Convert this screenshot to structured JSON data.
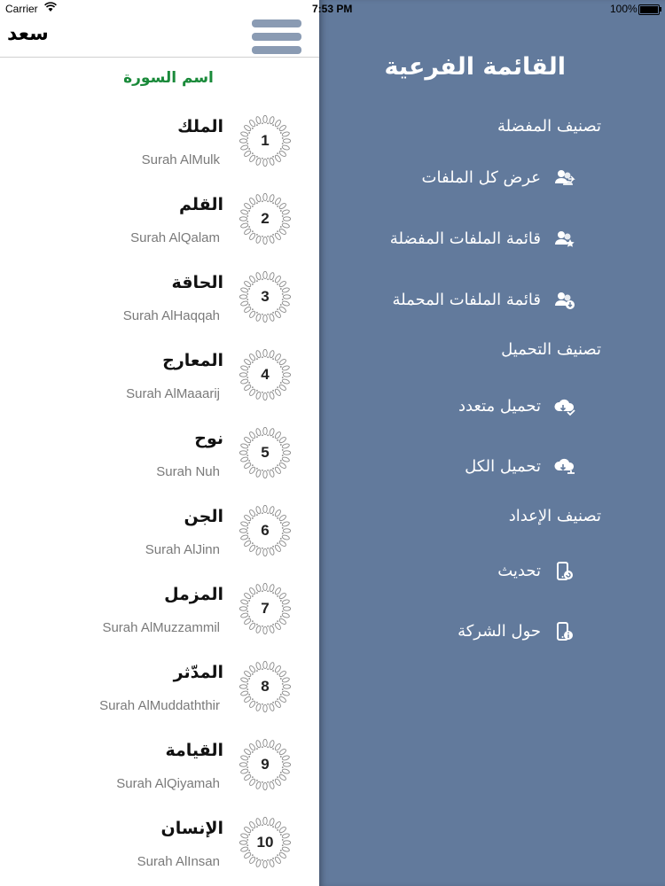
{
  "status_bar": {
    "carrier": "Carrier",
    "time": "7:53 PM",
    "battery": "100%"
  },
  "nav": {
    "title": "سعد"
  },
  "list": {
    "header": "اسم السورة",
    "items": [
      {
        "number": "1",
        "arabic": "الملك",
        "latin": "Surah AlMulk"
      },
      {
        "number": "2",
        "arabic": "القلم",
        "latin": "Surah AlQalam"
      },
      {
        "number": "3",
        "arabic": "الحاقة",
        "latin": "Surah AlHaqqah"
      },
      {
        "number": "4",
        "arabic": "المعارج",
        "latin": "Surah AlMaaarij"
      },
      {
        "number": "5",
        "arabic": "نوح",
        "latin": "Surah Nuh"
      },
      {
        "number": "6",
        "arabic": "الجن",
        "latin": "Surah AlJinn"
      },
      {
        "number": "7",
        "arabic": "المزمل",
        "latin": "Surah AlMuzzammil"
      },
      {
        "number": "8",
        "arabic": "المدّثر",
        "latin": "Surah AlMuddaththir"
      },
      {
        "number": "9",
        "arabic": "القيامة",
        "latin": "Surah AlQiyamah"
      },
      {
        "number": "10",
        "arabic": "الإنسان",
        "latin": "Surah AlInsan"
      }
    ]
  },
  "side_menu": {
    "title": "القائمة الفرعية",
    "sections": [
      {
        "header": "تصنيف المفضلة",
        "items": [
          {
            "label": "عرض كل الملفات",
            "icon": "users-icon"
          },
          {
            "label": "قائمة الملفات المفضلة",
            "icon": "users-star-icon"
          },
          {
            "label": "قائمة الملفات المحملة",
            "icon": "users-download-icon"
          }
        ]
      },
      {
        "header": "تصنيف التحميل",
        "items": [
          {
            "label": "تحميل متعدد",
            "icon": "cloud-download-icon"
          },
          {
            "label": "تحميل الكل",
            "icon": "cloud-download-all-icon"
          }
        ]
      },
      {
        "header": "تصنيف الإعداد",
        "items": [
          {
            "label": "تحديث",
            "icon": "device-refresh-icon"
          },
          {
            "label": "حول الشركة",
            "icon": "device-info-icon"
          }
        ]
      }
    ]
  },
  "colors": {
    "side_menu_bg": "#627a9c",
    "header_green": "#1a8a3a",
    "menu_button": "#8a9bb3"
  }
}
